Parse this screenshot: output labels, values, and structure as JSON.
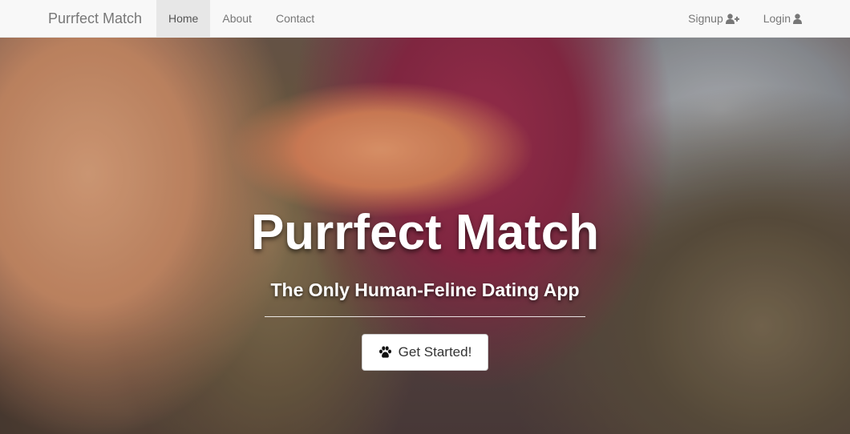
{
  "navbar": {
    "brand": "Purrfect Match",
    "links": [
      {
        "label": "Home",
        "active": true
      },
      {
        "label": "About",
        "active": false
      },
      {
        "label": "Contact",
        "active": false
      }
    ],
    "right": [
      {
        "label": "Signup",
        "icon": "user-plus-icon"
      },
      {
        "label": "Login",
        "icon": "user-icon"
      }
    ]
  },
  "hero": {
    "title": "Purrfect Match",
    "subtitle": "The Only Human-Feline Dating App",
    "cta_label": "Get Started!",
    "cta_icon": "paw-icon",
    "background": "photo of a human finger touching a cat's paw"
  },
  "colors": {
    "navbar_bg": "#f8f8f8",
    "active_tab_bg": "#e7e7e7",
    "nav_text": "#777777",
    "hero_text": "#ffffff"
  }
}
